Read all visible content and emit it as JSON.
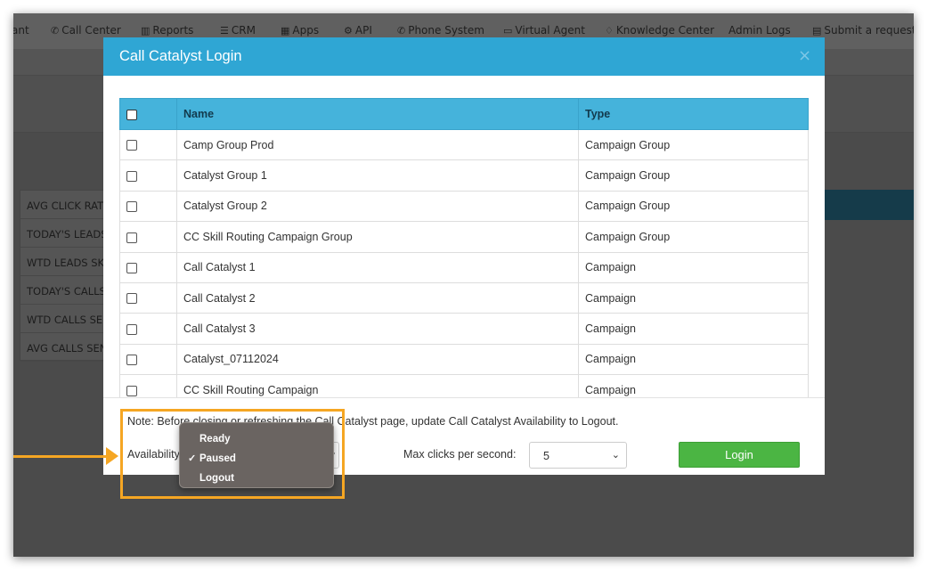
{
  "nav": {
    "items": [
      {
        "icon": "",
        "label": "ant"
      },
      {
        "icon": "phone-icon",
        "label": "Call Center"
      },
      {
        "icon": "bar-chart-icon",
        "label": "Reports"
      },
      {
        "icon": "list-icon",
        "label": "CRM"
      },
      {
        "icon": "grid-icon",
        "label": "Apps"
      },
      {
        "icon": "gear-icon",
        "label": "API"
      },
      {
        "icon": "phone-icon",
        "label": "Phone System"
      },
      {
        "icon": "monitor-icon",
        "label": "Virtual Agent"
      },
      {
        "icon": "lightbulb-icon",
        "label": "Knowledge Center"
      },
      {
        "icon": "",
        "label": "Admin Logs"
      },
      {
        "icon": "ticket-icon",
        "label": "Submit a request"
      }
    ]
  },
  "stats": {
    "rows": [
      "AVG CLICK RATE",
      "TODAY'S LEADS",
      "WTD LEADS SKI",
      "TODAY'S CALLS",
      "WTD CALLS SEN",
      "AVG CALLS SENT"
    ]
  },
  "modal": {
    "title": "Call Catalyst Login",
    "close_glyph": "×",
    "columns": {
      "name": "Name",
      "type": "Type"
    },
    "rows": [
      {
        "name": "Camp Group Prod",
        "type": "Campaign Group"
      },
      {
        "name": "Catalyst Group 1",
        "type": "Campaign Group"
      },
      {
        "name": "Catalyst Group 2",
        "type": "Campaign Group"
      },
      {
        "name": "CC Skill Routing Campaign Group",
        "type": "Campaign Group"
      },
      {
        "name": "Call Catalyst 1",
        "type": "Campaign"
      },
      {
        "name": "Call Catalyst 2",
        "type": "Campaign"
      },
      {
        "name": "Call Catalyst 3",
        "type": "Campaign"
      },
      {
        "name": "Catalyst_07112024",
        "type": "Campaign"
      },
      {
        "name": "CC Skill Routing Campaign",
        "type": "Campaign"
      }
    ],
    "footer": {
      "note": "Note: Before closing or refreshing the Call Catalyst page, update Call Catalyst Availability to Logout.",
      "availability_label": "Availability",
      "max_clicks_label": "Max clicks per second:",
      "max_clicks_value": "5",
      "login_label": "Login"
    }
  },
  "availability_dropdown": {
    "options": [
      "Ready",
      "Paused",
      "Logout"
    ],
    "selected": "Paused",
    "check_glyph": "✓"
  },
  "colors": {
    "header_blue": "#2fa6d4",
    "table_header": "#45b3db",
    "login_green": "#4bb543",
    "highlight_orange": "#f5a623"
  }
}
